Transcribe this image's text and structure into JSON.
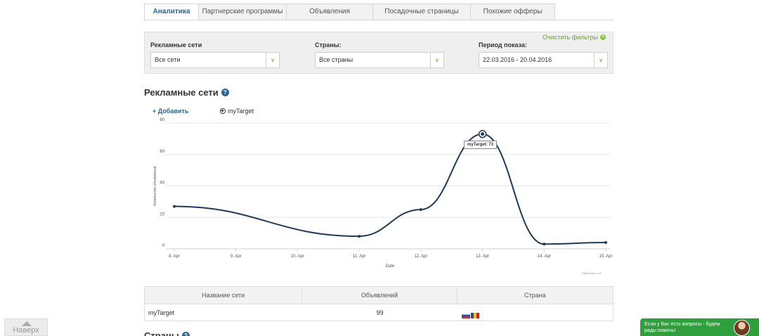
{
  "tabs": [
    {
      "label": "Аналитика",
      "active": true
    },
    {
      "label": "Партнерские программы",
      "active": false
    },
    {
      "label": "Объявления",
      "active": false
    },
    {
      "label": "Посадочные страницы",
      "active": false
    },
    {
      "label": "Похожие офферы",
      "active": false
    }
  ],
  "filters": {
    "clear_label": "Очистить фильтры",
    "networks": {
      "label": "Рекламные сети",
      "value": "Все сети"
    },
    "countries": {
      "label": "Страны:",
      "value": "Все страны"
    },
    "period": {
      "label": "Период показа:",
      "value": "22.03.2016 - 20.04.2016"
    }
  },
  "section": {
    "title": "Рекламные сети",
    "add_label": "+ Добавить"
  },
  "chart_data": {
    "type": "line",
    "categories": [
      "8. Apr",
      "9. Apr",
      "10. Apr",
      "11. Apr",
      "12. Apr",
      "13. Apr",
      "14. Apr",
      "15. Apr"
    ],
    "series": [
      {
        "name": "myTarget",
        "points": [
          [
            0,
            27
          ],
          [
            3,
            8
          ],
          [
            4,
            25
          ],
          [
            5,
            73
          ],
          [
            6,
            3
          ],
          [
            7,
            4
          ]
        ]
      }
    ],
    "xlabel": "Date",
    "ylabel": "Количество объявлений",
    "yticks": [
      0,
      20,
      40,
      60,
      80
    ],
    "ylim": [
      0,
      80
    ],
    "tooltip": "myTarget: 73",
    "credit": "Highcharts.com",
    "colors": {
      "line": "#1f3a5a",
      "grid": "#e6e6e6"
    }
  },
  "table": {
    "headers": [
      "Название сети",
      "Объявлений",
      "Страна"
    ],
    "rows": [
      {
        "network": "myTarget",
        "count": "99",
        "flags": [
          "ru",
          "md"
        ]
      }
    ]
  },
  "next_section_title": "Страны",
  "up_button": "Наверх",
  "chat_text": "Если у Вас есть вопросы - будем рады помочь!"
}
